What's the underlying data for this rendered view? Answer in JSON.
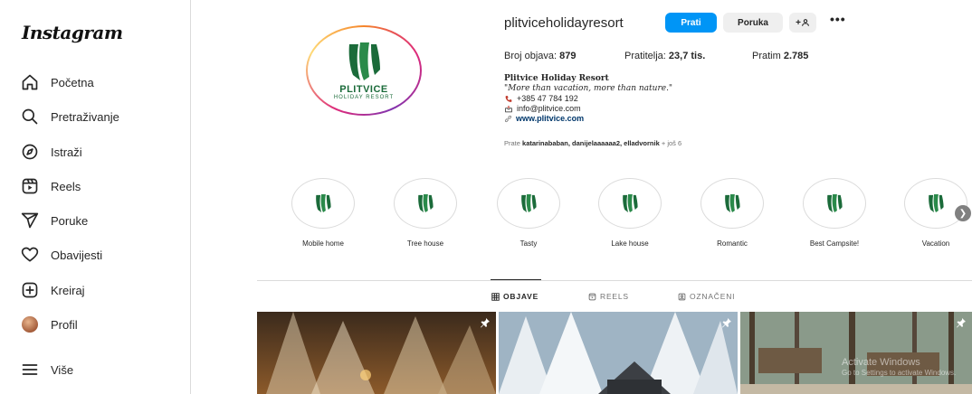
{
  "app": {
    "logo": "Instagram"
  },
  "sidebar": {
    "items": [
      {
        "label": "Početna",
        "icon": "home-icon"
      },
      {
        "label": "Pretraživanje",
        "icon": "search-icon"
      },
      {
        "label": "Istraži",
        "icon": "compass-icon"
      },
      {
        "label": "Reels",
        "icon": "reels-icon"
      },
      {
        "label": "Poruke",
        "icon": "send-icon"
      },
      {
        "label": "Obavijesti",
        "icon": "heart-icon"
      },
      {
        "label": "Kreiraj",
        "icon": "plus-square-icon"
      },
      {
        "label": "Profil",
        "icon": "avatar-icon"
      },
      {
        "label": "Više",
        "icon": "menu-icon"
      }
    ]
  },
  "profile": {
    "username": "plitviceholidayresort",
    "follow_label": "Prati",
    "message_label": "Poruka",
    "add_label": "+",
    "more_label": "•••",
    "logo_text": "PLITVICE",
    "logo_subtext": "HOLIDAY RESORT",
    "stats": {
      "posts_label": "Broj objava:",
      "posts_value": "879",
      "followers_label": "Pratitelja:",
      "followers_value": "23,7 tis.",
      "following_label": "Pratim",
      "following_value": "2.785"
    },
    "bio": {
      "name": "Plitvice Holiday Resort",
      "quote": "\"More than vacation, more than nature.\"",
      "phone": "+385 47 784 192",
      "email": "info@plitvice.com",
      "website": "www.plitvice.com"
    },
    "followed_by": {
      "prefix": "Prate",
      "names": "katarinababan, danijelaaaaaa2, elladvornik",
      "suffix": "+ još 6"
    }
  },
  "highlights": [
    {
      "label": "Mobile home"
    },
    {
      "label": "Tree house"
    },
    {
      "label": "Tasty"
    },
    {
      "label": "Lake house"
    },
    {
      "label": "Romantic"
    },
    {
      "label": "Best Campsite!"
    },
    {
      "label": "Vacation"
    }
  ],
  "tabs": [
    {
      "label": "OBJAVE",
      "active": true
    },
    {
      "label": "REELS",
      "active": false
    },
    {
      "label": "OZNAČENI",
      "active": false
    }
  ],
  "watermark": {
    "line1": "Activate Windows",
    "line2": "Go to Settings to activate Windows."
  },
  "colors": {
    "accent": "#0095f6",
    "brand_green": "#1b6b3a"
  }
}
